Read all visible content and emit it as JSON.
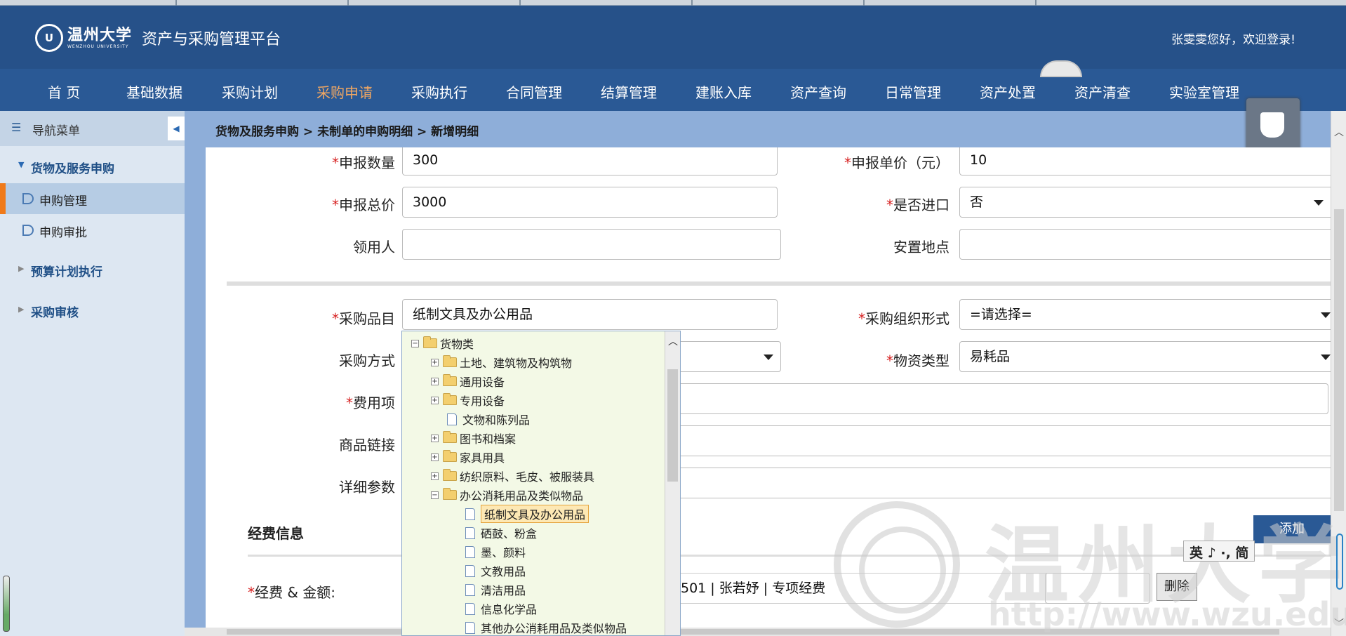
{
  "app": {
    "university": "温州大学",
    "university_en": "WENZHOU UNIVERSITY",
    "platform_title": "资产与采购管理平台",
    "welcome": "张雯雯您好，欢迎登录!",
    "colors": {
      "header": "#265189",
      "accent": "#f0a763",
      "required": "#d61f1f"
    }
  },
  "topnav": [
    {
      "label": "首 页"
    },
    {
      "label": "基础数据"
    },
    {
      "label": "采购计划"
    },
    {
      "label": "采购申请"
    },
    {
      "label": "采购执行"
    },
    {
      "label": "合同管理"
    },
    {
      "label": "结算管理"
    },
    {
      "label": "建账入库"
    },
    {
      "label": "资产查询"
    },
    {
      "label": "日常管理"
    },
    {
      "label": "资产处置"
    },
    {
      "label": "资产清查"
    },
    {
      "label": "实验室管理"
    }
  ],
  "topnav_active": "采购申请",
  "sidebar": {
    "title": "导航菜单",
    "groups": [
      {
        "label": "货物及服务申购",
        "expanded": true,
        "items": [
          {
            "label": "申购管理",
            "active": true
          },
          {
            "label": "申购审批"
          }
        ]
      },
      {
        "label": "预算计划执行",
        "expanded": false
      },
      {
        "label": "采购审核",
        "expanded": false
      }
    ]
  },
  "breadcrumb": "货物及服务申购 > 未制单的申购明细 > 新增明细",
  "form": {
    "qty_label": "申报数量",
    "qty": "300",
    "unit_price_label": "申报单价（元）",
    "unit_price": "10",
    "total_label": "申报总价",
    "total": "3000",
    "import_label": "是否进口",
    "import": "否",
    "recipient_label": "领用人",
    "recipient": "",
    "location_label": "安置地点",
    "location": "",
    "category_label": "采购品目",
    "category": "纸制文具及办公用品",
    "org_form_label": "采购组织形式",
    "org_form": "=请选择=",
    "method_label": "采购方式",
    "material_label": "物资类型",
    "material": "易耗品",
    "expense_label": "费用项",
    "link_label": "商品链接",
    "params_label": "详细参数"
  },
  "funding": {
    "section_title": "经费信息",
    "add_button": "添加",
    "amount_label": "经费 & 金额:",
    "fund_text": "501 | 张若妤 | 专项经费",
    "delete_button": "删除"
  },
  "tree": {
    "nodes": [
      {
        "label": "货物类",
        "type": "folder",
        "toggle": "−",
        "level": 0
      },
      {
        "label": "土地、建筑物及构筑物",
        "type": "folder",
        "toggle": "+",
        "level": 1
      },
      {
        "label": "通用设备",
        "type": "folder",
        "toggle": "+",
        "level": 1
      },
      {
        "label": "专用设备",
        "type": "folder",
        "toggle": "+",
        "level": 1
      },
      {
        "label": "文物和陈列品",
        "type": "doc",
        "level": 1
      },
      {
        "label": "图书和档案",
        "type": "folder",
        "toggle": "+",
        "level": 1
      },
      {
        "label": "家具用具",
        "type": "folder",
        "toggle": "+",
        "level": 1
      },
      {
        "label": "纺织原料、毛皮、被服装具",
        "type": "folder",
        "toggle": "+",
        "level": 1
      },
      {
        "label": "办公消耗用品及类似物品",
        "type": "folder",
        "toggle": "−",
        "level": 1
      },
      {
        "label": "纸制文具及办公用品",
        "type": "doc",
        "level": 2,
        "selected": true
      },
      {
        "label": "硒鼓、粉盒",
        "type": "doc",
        "level": 2
      },
      {
        "label": "墨、颜料",
        "type": "doc",
        "level": 2
      },
      {
        "label": "文教用品",
        "type": "doc",
        "level": 2
      },
      {
        "label": "清洁用品",
        "type": "doc",
        "level": 2
      },
      {
        "label": "信息化学品",
        "type": "doc",
        "level": 2
      },
      {
        "label": "其他办公消耗用品及类似物品",
        "type": "doc",
        "level": 2
      }
    ]
  },
  "watermark": {
    "text": "温州大学",
    "url": "http://www.wzu.edu.cn"
  },
  "ime": {
    "text": "英 ♪ ·, 简"
  }
}
